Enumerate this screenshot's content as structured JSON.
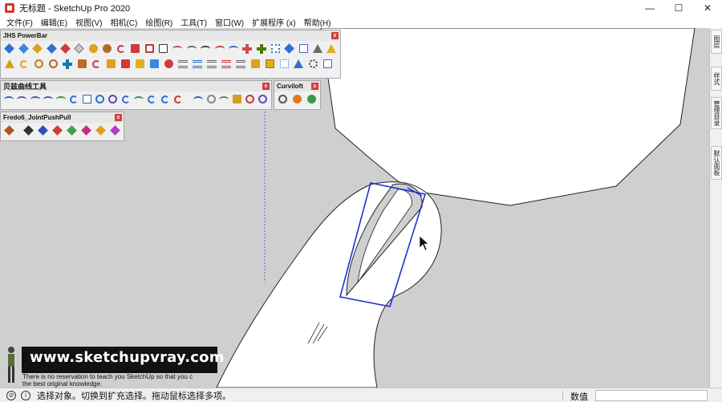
{
  "window": {
    "title": "无标题 - SketchUp Pro 2020",
    "controls": {
      "minimize": "—",
      "maximize": "☐",
      "close": "✕"
    }
  },
  "menu": [
    {
      "label": "文件(F)"
    },
    {
      "label": "编辑(E)"
    },
    {
      "label": "视图(V)"
    },
    {
      "label": "相机(C)"
    },
    {
      "label": "绘图(R)"
    },
    {
      "label": "工具(T)"
    },
    {
      "label": "窗口(W)"
    },
    {
      "label": "扩展程序 (x)"
    },
    {
      "label": "帮助(H)"
    }
  ],
  "toolbars": {
    "jhs": {
      "title": "JHS PowerBar",
      "close": "x"
    },
    "bezier": {
      "title": "贝兹曲线工具",
      "close": "x"
    },
    "curviloft": {
      "title": "Curviloft",
      "close": "x"
    },
    "fredo": {
      "title": "Fredo6_JointPushPull",
      "close": "x"
    }
  },
  "right_tray": {
    "tabs": [
      {
        "label": "图层"
      },
      {
        "label": "样式"
      },
      {
        "label": "管理目录"
      },
      {
        "label": "默认面板"
      }
    ]
  },
  "watermark": {
    "site": "www.sketchupvray.com",
    "line1": "There is no reservation to teach you SketchUp so that you c",
    "line2": "the best original knowledge."
  },
  "status": {
    "message": "选择对象。切换到扩充选择。拖动鼠标选择多项。",
    "measure_label": "数值",
    "measure_value": ""
  },
  "colors": {
    "viewport_bg": "#cfcfcf",
    "selection_blue": "#1f2fd0",
    "surface_white": "#ffffff"
  }
}
